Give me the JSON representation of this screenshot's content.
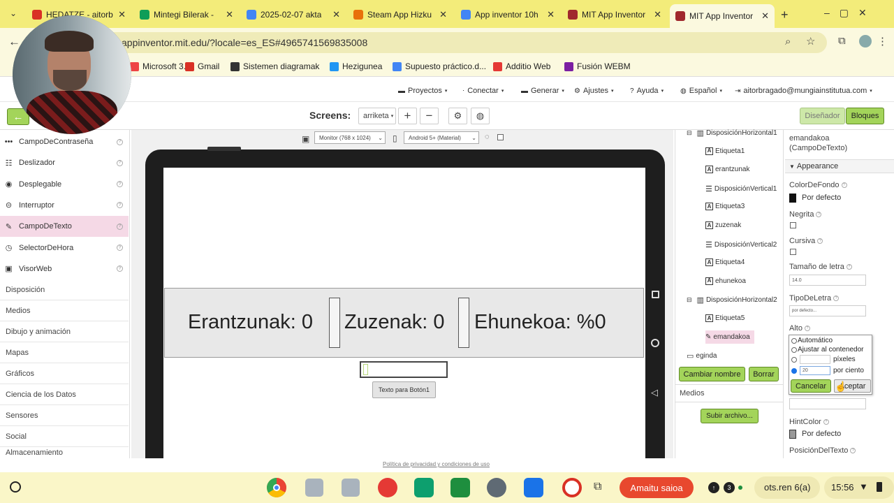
{
  "browser": {
    "tabs": [
      {
        "title": "HEDATZE - aitorb",
        "color": "#d93025"
      },
      {
        "title": "Mintegi Bilerak - ",
        "color": "#0f9d58"
      },
      {
        "title": "2025-02-07 akta",
        "color": "#4285f4"
      },
      {
        "title": "Steam App Hizku",
        "color": "#e8710a"
      },
      {
        "title": "App inventor 10h",
        "color": "#4285f4"
      },
      {
        "title": "MIT App Inventor",
        "color": "#a0282d"
      },
      {
        "title": "MIT App Inventor",
        "color": "#a0282d"
      }
    ],
    "new_tab": "+",
    "url": "appinventor.mit.edu/?locale=es_ES#4965741569835008",
    "bookmarks": [
      {
        "label": "Microsoft 3...",
        "color": "#e44"
      },
      {
        "label": "Gmail",
        "color": "#d93025"
      },
      {
        "label": "Sistemen diagramak",
        "color": "#333"
      },
      {
        "label": "Hezigunea",
        "color": "#2196f3"
      },
      {
        "label": "Supuesto práctico.d...",
        "color": "#4285f4"
      },
      {
        "label": "Additio Web",
        "color": "#e53935"
      },
      {
        "label": "Fusión WEBM",
        "color": "#7b1fa2"
      }
    ]
  },
  "menu": {
    "items": [
      "Proyectos",
      "Conectar",
      "Generar",
      "Ajustes",
      "Ayuda",
      "Español",
      "aitorbragado@mungiainstitutua.com"
    ]
  },
  "screens": {
    "label": "Screens:",
    "current": "arriketa",
    "add": "+",
    "remove": "−",
    "designer": "Diseñador",
    "blocks": "Bloques"
  },
  "palette": {
    "items": [
      {
        "label": "CampoDeContraseña",
        "icon": "•••"
      },
      {
        "label": "Deslizador",
        "icon": "☷"
      },
      {
        "label": "Desplegable",
        "icon": "◉"
      },
      {
        "label": "Interruptor",
        "icon": "⊝"
      },
      {
        "label": "CampoDeTexto",
        "icon": "✎",
        "selected": true
      },
      {
        "label": "SelectorDeHora",
        "icon": "◷"
      },
      {
        "label": "VisorWeb",
        "icon": "▣"
      }
    ],
    "categories": [
      "Disposición",
      "Medios",
      "Dibujo y animación",
      "Mapas",
      "Gráficos",
      "Ciencia de los Datos",
      "Sensores",
      "Social",
      "Almacenamiento"
    ]
  },
  "viewer": {
    "monitor": "Monitor (768 x 1024)",
    "android": "Android 5+ (Material)",
    "labels": [
      "Erantzunak: 0",
      "Zuzenak: 0",
      "Ehunekoa: %0"
    ],
    "button_text": "Texto para Botón1"
  },
  "tree": {
    "items": [
      {
        "label": "DisposiciónHorizontal1",
        "type": "hz",
        "indent": 0,
        "toggle": "⊟"
      },
      {
        "label": "Etiqueta1",
        "type": "label",
        "indent": 1
      },
      {
        "label": "erantzunak",
        "type": "label",
        "indent": 1
      },
      {
        "label": "DisposiciónVertical1",
        "type": "vt",
        "indent": 1
      },
      {
        "label": "Etiqueta3",
        "type": "label",
        "indent": 1
      },
      {
        "label": "zuzenak",
        "type": "label",
        "indent": 1
      },
      {
        "label": "DisposiciónVertical2",
        "type": "vt",
        "indent": 1
      },
      {
        "label": "Etiqueta4",
        "type": "label",
        "indent": 1
      },
      {
        "label": "ehunekoa",
        "type": "label",
        "indent": 1
      },
      {
        "label": "DisposiciónHorizontal2",
        "type": "hz",
        "indent": 0,
        "toggle": "⊟"
      },
      {
        "label": "Etiqueta5",
        "type": "label",
        "indent": 1
      },
      {
        "label": "emandakoa",
        "type": "text",
        "indent": 1,
        "selected": true
      },
      {
        "label": "egindа",
        "type": "btn",
        "indent": 0
      }
    ],
    "rename": "Cambiar nombre",
    "delete": "Borrar",
    "media": "Medios",
    "upload": "Subir archivo..."
  },
  "props": {
    "component": "emandakoa (CampoDeTexto)",
    "section": "Appearance",
    "bg_label": "ColorDeFondo",
    "bg_value": "Por defecto",
    "bold_label": "Negrita",
    "italic_label": "Cursiva",
    "fontsize_label": "Tamaño de letra",
    "fontsize_value": "14.0",
    "typeface_label": "TipoDeLetra",
    "typeface_value": "por defecto...",
    "height_label": "Alto",
    "height_options": [
      "Automático",
      "Ajustar al contenedor",
      "píxeles",
      "por ciento"
    ],
    "height_value": "20",
    "cancel": "Cancelar",
    "accept": "Aceptar",
    "hint_label": "HintColor",
    "hint_value": "Por defecto",
    "pos_label": "PosiciónDelTexto"
  },
  "footer": "Política de privacidad y condiciones de uso",
  "taskbar": {
    "record": "Amaitu saioa",
    "notif_count": "3",
    "network": "ots.ren 6(a)",
    "time": "15:56"
  }
}
